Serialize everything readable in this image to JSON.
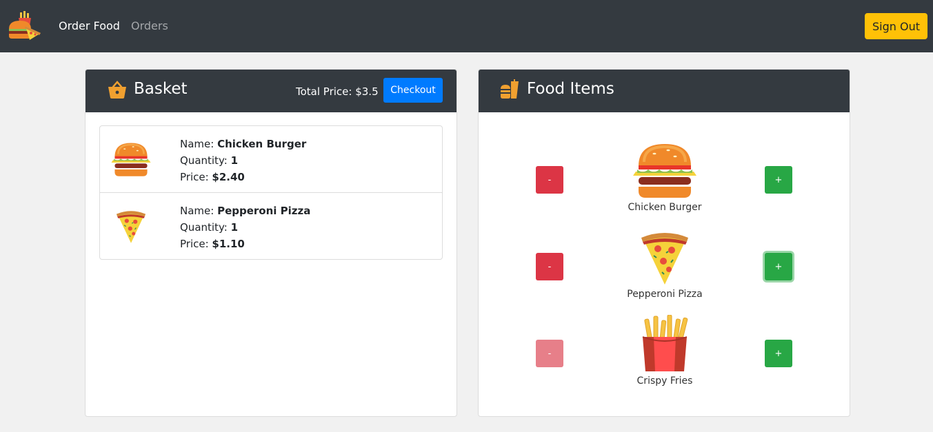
{
  "nav": {
    "links": [
      "Order Food",
      "Orders"
    ],
    "signout_label": "Sign Out"
  },
  "basket": {
    "title": "Basket",
    "total_label": "Total Price: $3.5",
    "checkout_label": "Checkout",
    "items": [
      {
        "name_label": "Name: ",
        "name": "Chicken Burger",
        "qty_label": "Quantity: ",
        "qty": "1",
        "price_label": "Price: ",
        "price": "$2.40",
        "icon": "burger-icon"
      },
      {
        "name_label": "Name: ",
        "name": "Pepperoni Pizza",
        "qty_label": "Quantity: ",
        "qty": "1",
        "price_label": "Price: ",
        "price": "$1.10",
        "icon": "pizza-icon"
      }
    ]
  },
  "food": {
    "title": "Food Items",
    "minus_label": "-",
    "plus_label": "+",
    "items": [
      {
        "name": "Chicken Burger",
        "icon": "burger-icon"
      },
      {
        "name": "Pepperoni Pizza",
        "icon": "pizza-icon"
      },
      {
        "name": "Crispy Fries",
        "icon": "fries-icon"
      }
    ]
  },
  "colors": {
    "navbar": "#343a40",
    "accent_yellow": "#ffc107",
    "checkout_blue": "#007bff",
    "minus_red": "#dc3545",
    "plus_green": "#28a745"
  }
}
